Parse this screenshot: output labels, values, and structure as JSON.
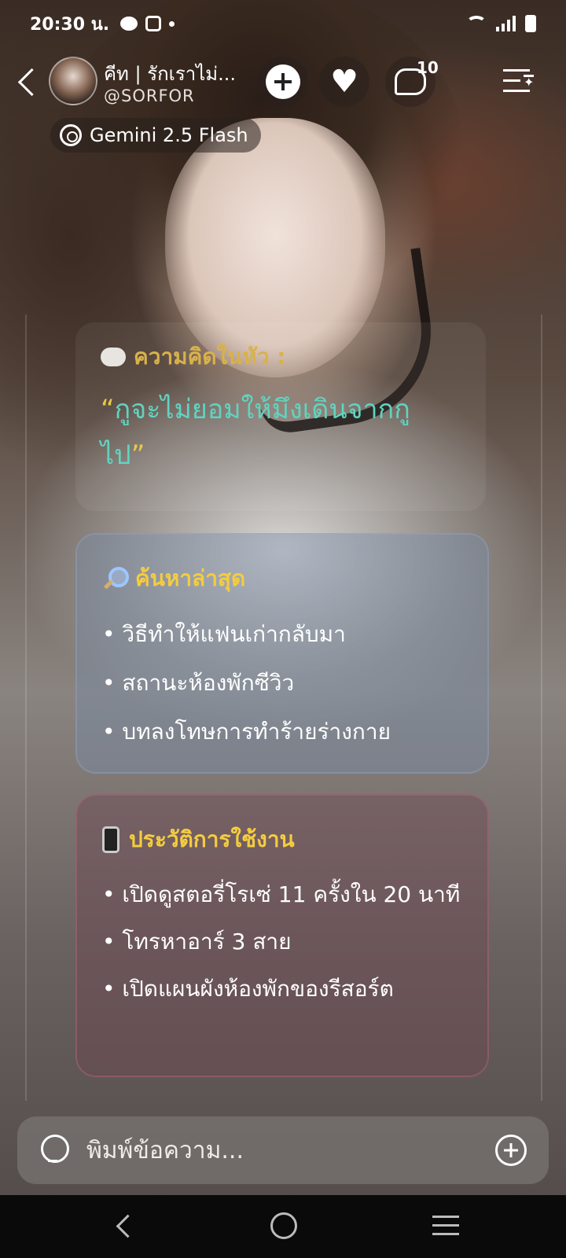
{
  "status_bar": {
    "time": "20:30 น."
  },
  "header": {
    "character_name": "คีท | รักเราไม่...",
    "handle": "@SORFOR",
    "comment_count": "10",
    "model_name": "Gemini 2.5 Flash"
  },
  "thought": {
    "title": "ความคิดในหัว :",
    "quote_open": "“",
    "quote_text": "กูจะไม่ยอมให้มึงเดินจากกูไป",
    "quote_close": "”"
  },
  "search_card": {
    "title": "ค้นหาล่าสุด",
    "items": [
      "• วิธีทำให้แฟนเก่ากลับมา",
      "• สถานะห้องพักซีวิว",
      "• บทลงโทษการทำร้ายร่างกาย"
    ]
  },
  "history_card": {
    "title": "ประวัติการใช้งาน",
    "items": [
      "• เปิดดูสตอรี่โรเซ่ 11 ครั้งใน 20 นาที",
      "• โทรหาอาร์ 3 สาย",
      "• เปิดแผนผังห้องพักของรีสอร์ต"
    ]
  },
  "input": {
    "placeholder": "พิมพ์ข้อความ..."
  },
  "icons": {
    "back": "back-chevron-icon",
    "add": "plus-icon",
    "like": "heart-icon",
    "comments": "comment-bubble-icon",
    "menu": "menu-sparkle-icon",
    "model": "model-switch-icon",
    "thought": "thought-cloud-icon",
    "search": "magnifier-icon",
    "history": "phone-icon",
    "hint": "lightbulb-icon",
    "attach": "plus-circle-icon"
  },
  "colors": {
    "accent_yellow": "#f4cc40",
    "quote_teal": "#5fd4c0",
    "thought_gold": "#d8b24a"
  }
}
